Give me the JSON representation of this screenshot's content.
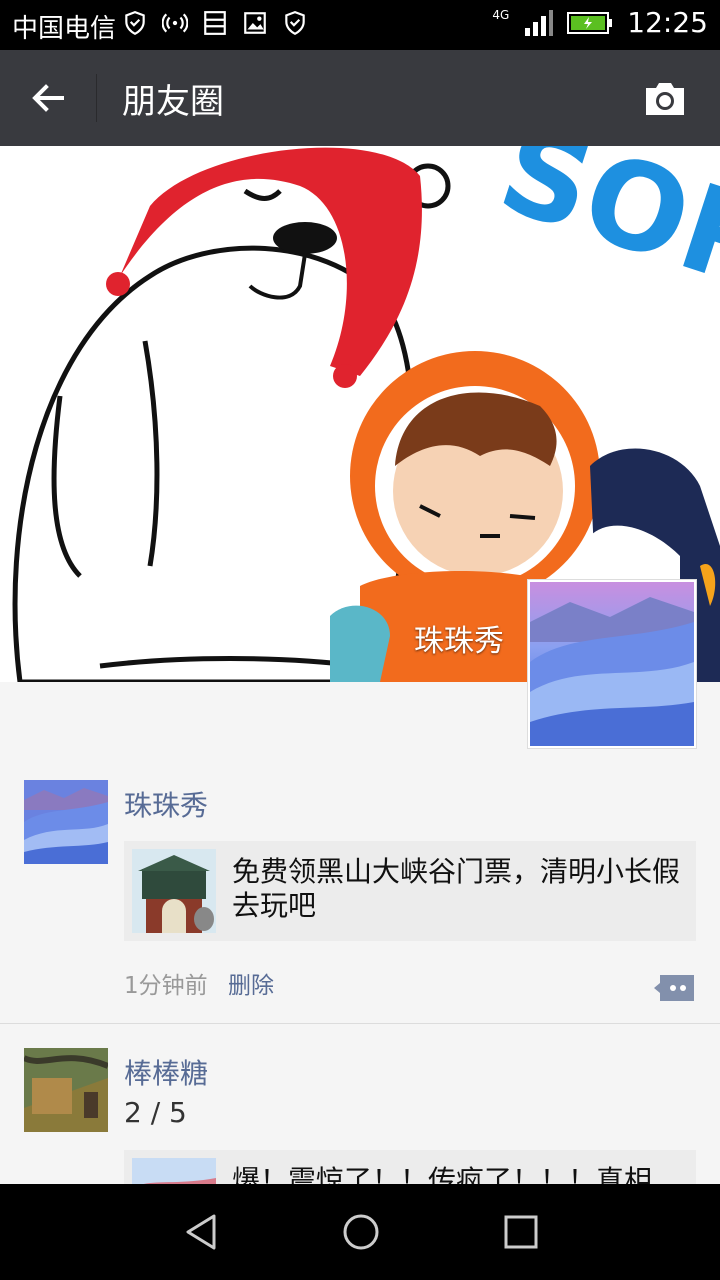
{
  "status_bar": {
    "carrier": "中国电信",
    "network": "4G",
    "time": "12:25"
  },
  "app_bar": {
    "title": "朋友圈"
  },
  "profile": {
    "name": "珠珠秀"
  },
  "posts": [
    {
      "name": "珠珠秀",
      "link_text": "免费领黑山大峡谷门票，清明小长假去玩吧",
      "time": "1分钟前",
      "delete_label": "删除"
    },
    {
      "name": "棒棒糖",
      "subtext": "2 / 5",
      "link_text": "爆！震惊了！！传疯了！！！真相"
    }
  ],
  "colors": {
    "link_blue": "#576b95",
    "app_bar_bg": "#393a3f"
  }
}
